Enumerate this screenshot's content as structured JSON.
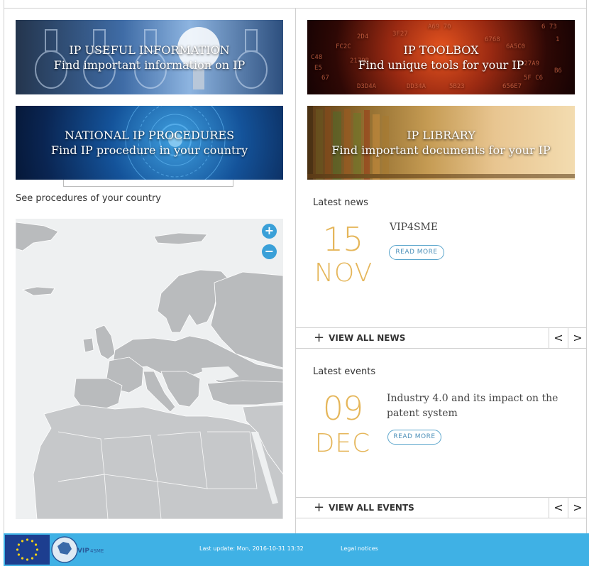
{
  "banners": {
    "useful": {
      "title": "IP USEFUL INFORMATION",
      "subtitle": "Find important information on IP"
    },
    "toolbox": {
      "title": "IP TOOLBOX",
      "subtitle": "Find unique tools for your IP"
    },
    "procedures": {
      "title": "NATIONAL IP PROCEDURES",
      "subtitle": "Find IP procedure in your country"
    },
    "library": {
      "title": "IP LIBRARY",
      "subtitle": "Find important documents for your IP"
    },
    "toolbox_hex": [
      "A69 70",
      "2D4",
      "6 73",
      "FC2C",
      "6A5C0",
      "C48",
      "2179B",
      "1",
      "6768",
      "227A9",
      "DD34A",
      "5B23",
      "656E7",
      "D3D4A",
      "67",
      "B6",
      "5F C6",
      "3F27",
      "E5"
    ]
  },
  "map": {
    "title": "See procedures of your country",
    "zoom_in": "+",
    "zoom_out": "−"
  },
  "news": {
    "section_title": "Latest news",
    "day": "15",
    "month": "NOV",
    "title": "VIP4SME",
    "read_more": "READ MORE",
    "view_all": "VIEW ALL NEWS",
    "plus": "+"
  },
  "events": {
    "section_title": "Latest events",
    "day": "09",
    "month": "DEC",
    "title_line1": "Industry 4.0 and its impact on the",
    "title_line2": "patent system",
    "read_more": "READ MORE",
    "view_all": "VIEW ALL EVENTS",
    "plus": "+"
  },
  "nav": {
    "prev": "<",
    "next": ">"
  },
  "footer": {
    "logo_text_vip": "VIP",
    "logo_text_sme": "4SME",
    "last_update": "Last update: Mon, 2016-10-31 13:32",
    "legal": "Legal notices",
    "colors": {
      "bar": "#3fb1e5",
      "flag": "#1d3e8f",
      "star": "#f5d316"
    }
  },
  "colors": {
    "accent_date": "#e5b65a",
    "link_blue": "#4b8fb8",
    "zoom": "#3aa0d8",
    "land": "#b9bbbd",
    "sea": "#eef0f1"
  }
}
